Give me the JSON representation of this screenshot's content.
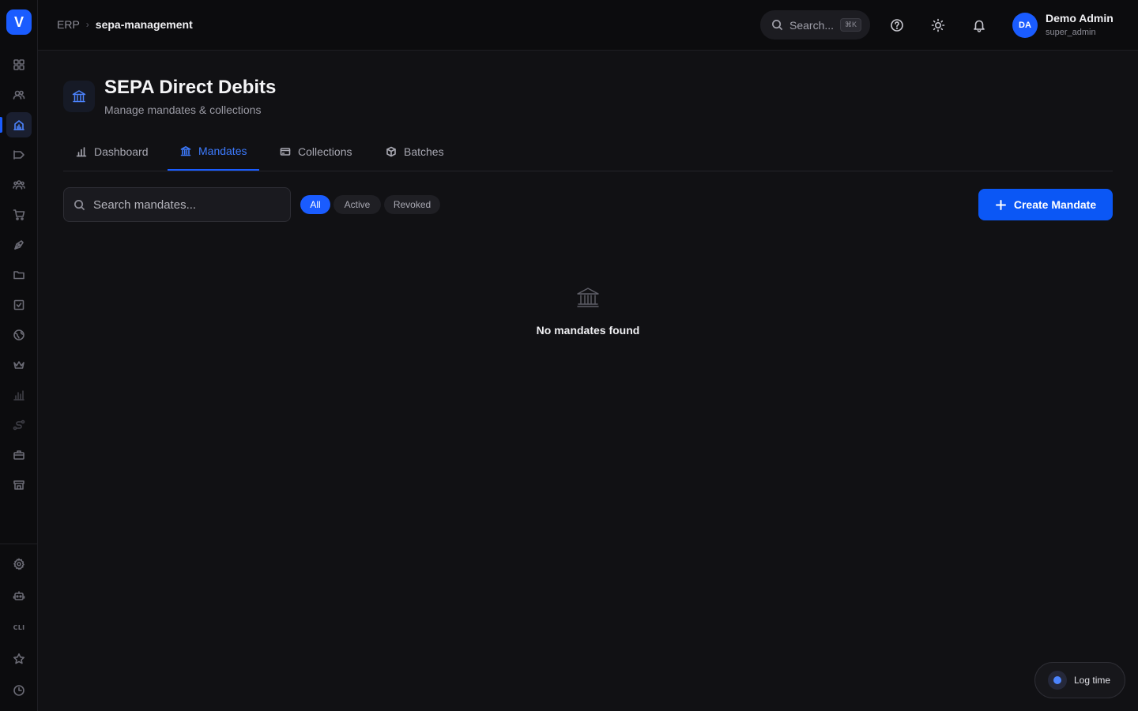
{
  "app": {
    "logo_letter": "V",
    "accent": "#1a5cff"
  },
  "sidebar": {
    "items": [
      {
        "icon": "grid-icon"
      },
      {
        "icon": "users-icon"
      },
      {
        "icon": "bank-chart-icon",
        "active": true
      },
      {
        "icon": "megaphone-icon"
      },
      {
        "icon": "team-icon"
      },
      {
        "icon": "cart-icon"
      },
      {
        "icon": "pen-tool-icon"
      },
      {
        "icon": "folder-icon"
      },
      {
        "icon": "checkbox-icon"
      },
      {
        "icon": "globe-icon"
      },
      {
        "icon": "crown-icon"
      },
      {
        "icon": "bar-chart-icon"
      },
      {
        "icon": "route-icon"
      },
      {
        "icon": "briefcase-icon"
      },
      {
        "icon": "store-icon"
      }
    ],
    "bottom_items": [
      {
        "icon": "settings-icon"
      },
      {
        "icon": "robot-icon"
      },
      {
        "label": "CLI"
      },
      {
        "icon": "star-icon"
      },
      {
        "icon": "clock-icon"
      }
    ]
  },
  "header": {
    "breadcrumb_root": "ERP",
    "breadcrumb_current": "sepa-management",
    "search_placeholder": "Search...",
    "search_shortcut": "⌘K",
    "user_initials": "DA",
    "user_name": "Demo Admin",
    "user_role": "super_admin"
  },
  "page": {
    "title": "SEPA Direct Debits",
    "subtitle": "Manage mandates & collections"
  },
  "tabs": [
    {
      "label": "Dashboard",
      "icon": "bar-chart-icon"
    },
    {
      "label": "Mandates",
      "icon": "bank-icon",
      "active": true
    },
    {
      "label": "Collections",
      "icon": "credit-card-icon"
    },
    {
      "label": "Batches",
      "icon": "package-icon"
    }
  ],
  "toolbar": {
    "search_placeholder": "Search mandates...",
    "filters": [
      "All",
      "Active",
      "Revoked"
    ],
    "active_filter": "All",
    "create_label": "Create Mandate"
  },
  "empty_state": {
    "message": "No mandates found",
    "icon": "bank-icon"
  },
  "log_time": {
    "label": "Log time"
  }
}
